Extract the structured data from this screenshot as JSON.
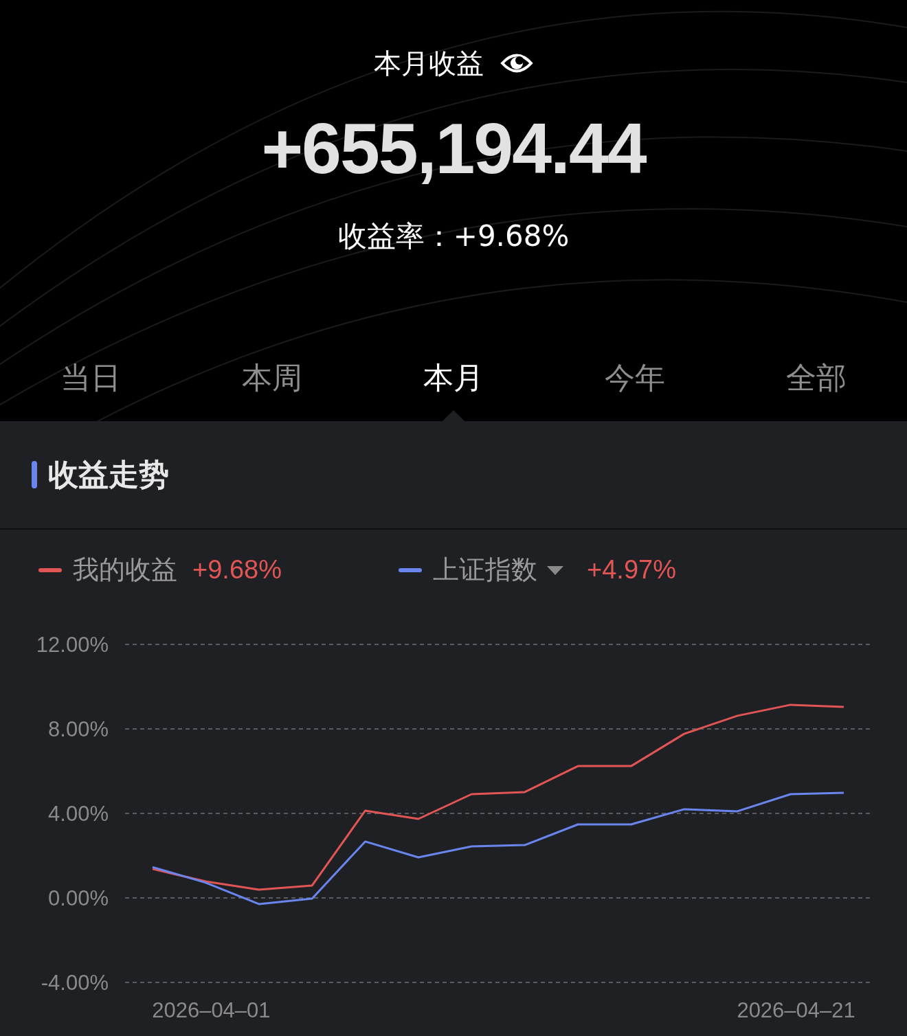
{
  "summary": {
    "title": "本月收益",
    "amount": "+655,194.44",
    "rate_label": "收益率：",
    "rate": "+9.68%"
  },
  "tabs": [
    {
      "label": "当日",
      "selected": false
    },
    {
      "label": "本周",
      "selected": false
    },
    {
      "label": "本月",
      "selected": true
    },
    {
      "label": "今年",
      "selected": false
    },
    {
      "label": "全部",
      "selected": false
    }
  ],
  "section": {
    "title": "收益走势"
  },
  "legend": [
    {
      "value": "+9.68%",
      "dropdown": false
    },
    {
      "value": "+4.97%",
      "dropdown": true
    }
  ],
  "chart_data": {
    "type": "line",
    "categories": [
      null,
      "2026–04–01",
      null,
      null,
      null,
      null,
      null,
      null,
      null,
      null,
      null,
      null,
      "2026–04–21",
      null
    ],
    "grid": true,
    "series": [
      {
        "name": "我的收益",
        "color": "#e25555",
        "values": [
          1.37,
          0.78,
          0.39,
          0.59,
          4.13,
          3.74,
          4.91,
          5.01,
          6.24,
          6.24,
          7.77,
          8.62,
          9.14,
          9.04
        ]
      },
      {
        "name": "上证指数",
        "color": "#6a86ee",
        "values": [
          1.46,
          0.72,
          -0.29,
          -0.03,
          2.67,
          1.92,
          2.44,
          2.5,
          3.48,
          3.48,
          4.2,
          4.1,
          4.91,
          4.98
        ]
      }
    ],
    "ylim": [
      -4,
      12
    ],
    "yticks": [
      {
        "value": 12,
        "label": "12.00%"
      },
      {
        "value": 8,
        "label": "8.00%"
      },
      {
        "value": 4,
        "label": "4.00%"
      },
      {
        "value": 0,
        "label": "0.00%"
      },
      {
        "value": -4,
        "label": "-4.00%"
      }
    ]
  }
}
